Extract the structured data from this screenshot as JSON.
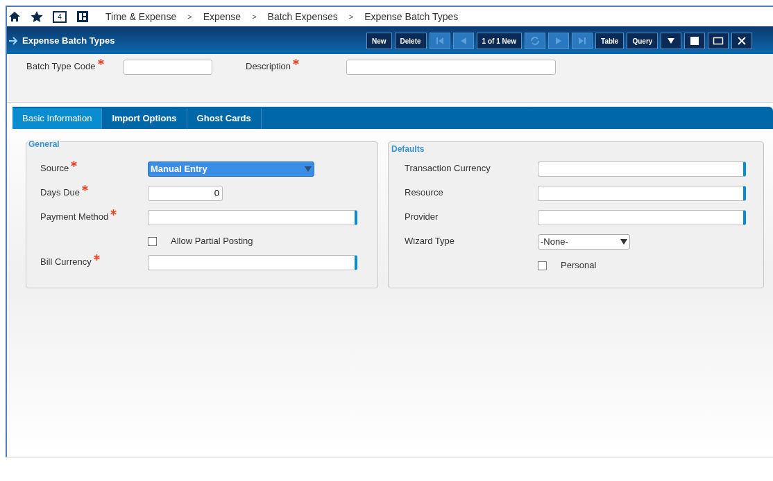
{
  "breadcrumb": {
    "badge": "4",
    "items": [
      "Time & Expense",
      "Expense",
      "Batch Expenses",
      "Expense Batch Types"
    ],
    "separator": ">"
  },
  "title_bar": {
    "title": "Expense Batch Types"
  },
  "toolbar": [
    {
      "kind": "text",
      "label": "New",
      "disabled": false
    },
    {
      "kind": "text",
      "label": "Delete",
      "disabled": false
    },
    {
      "kind": "first",
      "disabled": true
    },
    {
      "kind": "prev",
      "disabled": true
    },
    {
      "kind": "text",
      "label": "1 of 1 New",
      "disabled": false
    },
    {
      "kind": "refresh",
      "disabled": true
    },
    {
      "kind": "next",
      "disabled": true
    },
    {
      "kind": "last",
      "disabled": true
    },
    {
      "kind": "text",
      "label": "Table",
      "disabled": false
    },
    {
      "kind": "text",
      "label": "Query",
      "disabled": false
    },
    {
      "kind": "caret",
      "disabled": false
    },
    {
      "kind": "filled",
      "disabled": false
    },
    {
      "kind": "outline",
      "disabled": false
    },
    {
      "kind": "close",
      "disabled": false
    }
  ],
  "header_fields": [
    {
      "label": "Batch Type Code",
      "required": true
    },
    {
      "label": "Description",
      "required": true
    }
  ],
  "tabs": [
    {
      "label": "Basic Information",
      "selected": true
    },
    {
      "label": "Import Options",
      "selected": false
    },
    {
      "label": "Ghost Cards",
      "selected": false
    }
  ],
  "general": {
    "title": "General",
    "rows": [
      {
        "kind": "select",
        "label": "Source",
        "required": true,
        "value": "Manual Entry",
        "highlighted": true
      },
      {
        "kind": "number",
        "label": "Days Due",
        "required": true,
        "value": "0"
      },
      {
        "kind": "lookup",
        "label": "Payment Method",
        "required": true
      },
      {
        "kind": "checkbox",
        "label": "Allow Partial Posting",
        "checked": false
      },
      {
        "kind": "lookup",
        "label": "Bill Currency",
        "required": true
      }
    ]
  },
  "defaults": {
    "title": "Defaults",
    "rows": [
      {
        "kind": "lookup",
        "label": "Transaction Currency",
        "required": false
      },
      {
        "kind": "lookup",
        "label": "Resource",
        "required": false
      },
      {
        "kind": "lookup",
        "label": "Provider",
        "required": false
      },
      {
        "kind": "select",
        "label": "Wizard Type",
        "required": false,
        "value": "-None-",
        "highlighted": false
      },
      {
        "kind": "checkbox",
        "label": "Personal",
        "checked": false
      }
    ]
  }
}
